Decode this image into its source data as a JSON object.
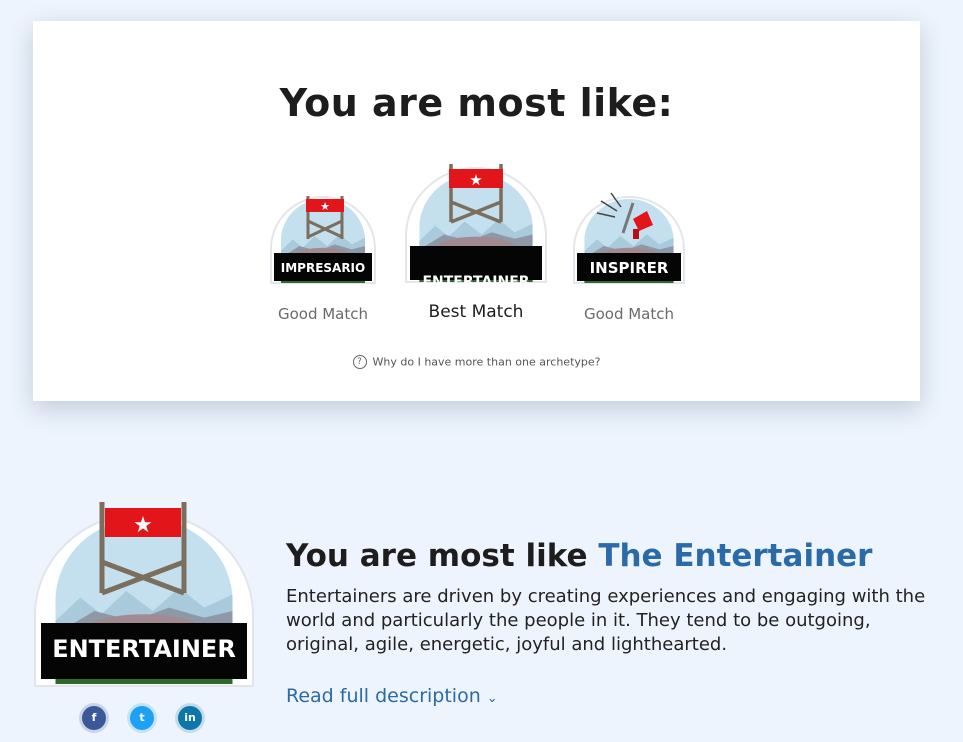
{
  "results_card": {
    "title": "You are most like:",
    "badges": [
      {
        "label": "IMPRESARIO",
        "match": "Good Match"
      },
      {
        "label": "ENTERTAINER",
        "match": "Best Match"
      },
      {
        "label": "INSPIRER",
        "match": "Good Match"
      }
    ],
    "why_link": "Why do I have more than one archetype?"
  },
  "detail": {
    "badge_label": "ENTERTAINER",
    "headline_prefix": "You are most like",
    "headline_accent": "The Entertainer",
    "description": "Entertainers are driven by creating experiences and engaging with the world and particularly the people in it. They tend to be outgoing, original, agile, energetic, joyful and lighthearted.",
    "read_more": "Read full description",
    "share": [
      {
        "network": "facebook",
        "glyph": "f",
        "color": "#3b5998"
      },
      {
        "network": "twitter",
        "glyph": "t",
        "color": "#1da1f2"
      },
      {
        "network": "linkedin",
        "glyph": "in",
        "color": "#0e76a8"
      }
    ]
  },
  "colors": {
    "accent": "#2a6aa6",
    "page_bg": "#edf4fd",
    "flag_red": "#e2151b"
  }
}
